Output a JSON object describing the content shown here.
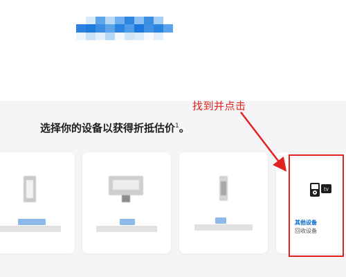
{
  "annotation": {
    "text": "找到并点击"
  },
  "section": {
    "heading": "选择你的设备以获得折抵估价",
    "heading_sup": "1",
    "heading_suffix": "。"
  },
  "devices": [
    {
      "label": "",
      "sub": "",
      "icon": "phone-icon"
    },
    {
      "label": "",
      "sub": "",
      "icon": "desktop-icon"
    },
    {
      "label": "",
      "sub": "",
      "icon": "watch-icon"
    },
    {
      "label": "其他设备",
      "sub": "回收设备",
      "icon": "ipod-appletv-icon"
    }
  ],
  "other_device_icon": {
    "tv_glyph": "tv"
  },
  "colors": {
    "accent_red": "#e0231c",
    "link_blue": "#0066cc",
    "section_bg": "#f5f5f7"
  }
}
